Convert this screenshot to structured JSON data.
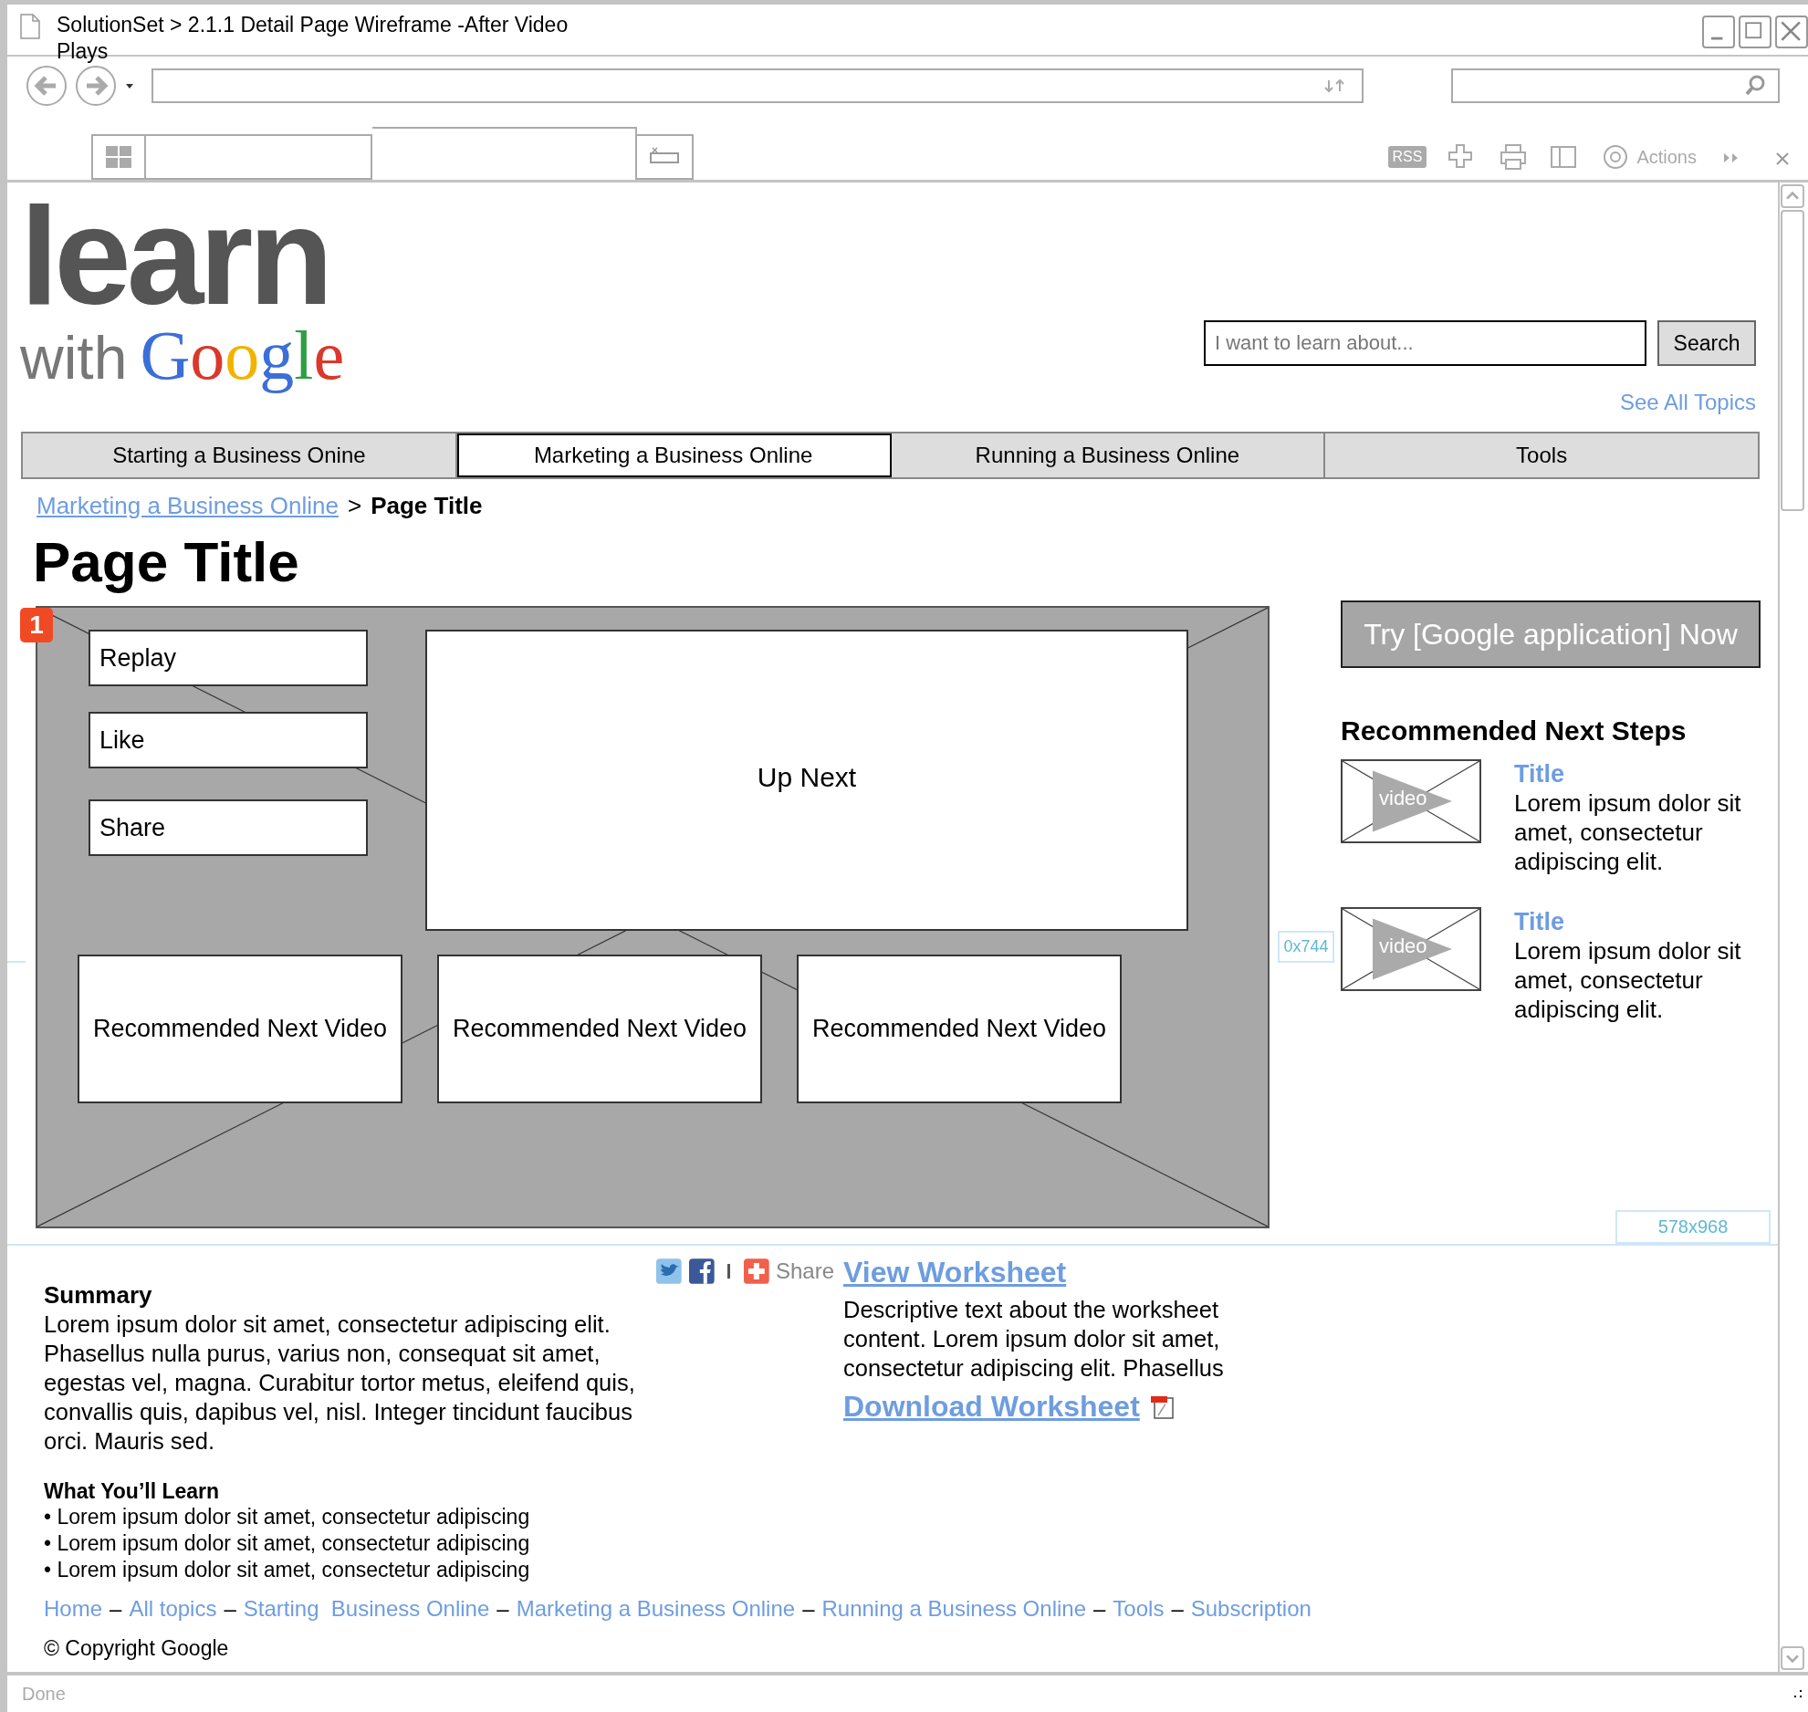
{
  "window": {
    "title": "SolutionSet > 2.1.1 Detail Page Wireframe -After Video Plays"
  },
  "toolbar": {
    "rss": "RSS",
    "actions": "Actions"
  },
  "header": {
    "logo_top": "learn",
    "logo_with": "with",
    "logo_google": "Google",
    "search": {
      "placeholder": "I want to learn about...",
      "button": "Search"
    },
    "see_all": "See All Topics"
  },
  "nav_tabs": [
    {
      "label": "Starting a Business Onine",
      "selected": false
    },
    {
      "label": "Marketing a Business Online",
      "selected": true
    },
    {
      "label": "Running a Business Online",
      "selected": false
    },
    {
      "label": "Tools",
      "selected": false
    }
  ],
  "breadcrumb": {
    "link": "Marketing a Business Online",
    "separator": ">",
    "current": "Page Title"
  },
  "page_title": "Page Title",
  "annotation_badge": "1",
  "video": {
    "actions": [
      "Replay",
      "Like",
      "Share"
    ],
    "up_next": "Up Next",
    "recommended": [
      "Recommended Next Video",
      "Recommended Next Video",
      "Recommended Next Video"
    ]
  },
  "guides": [
    "0x744",
    "578x968"
  ],
  "sidebar": {
    "cta": "Try [Google application] Now",
    "heading": "Recommended Next Steps",
    "items": [
      {
        "thumb_label": "video",
        "title": "Title",
        "text": "Lorem ipsum dolor sit amet, consectetur adipiscing elit."
      },
      {
        "thumb_label": "video",
        "title": "Title",
        "text": "Lorem ipsum dolor sit amet, consectetur adipiscing elit."
      }
    ]
  },
  "summary": {
    "heading": "Summary",
    "text": "Lorem ipsum dolor sit amet, consectetur adipiscing elit. Phasellus nulla purus, varius non, consequat sit amet, egestas vel, magna. Curabitur tortor metus, eleifend quis, convallis quis, dapibus vel, nisl. Integer tincidunt faucibus orci. Mauris sed.",
    "share_label": "Share"
  },
  "learn": {
    "heading": "What You’ll Learn",
    "bullets": [
      "• Lorem ipsum dolor sit amet, consectetur adipiscing",
      "• Lorem ipsum dolor sit amet, consectetur adipiscing",
      "• Lorem ipsum dolor sit amet, consectetur adipiscing"
    ]
  },
  "worksheet": {
    "view": "View Worksheet",
    "description": "Descriptive text about the worksheet content. Lorem ipsum dolor sit amet, consectetur adipiscing elit. Phasellus",
    "download": "Download Worksheet"
  },
  "footer": {
    "items": [
      {
        "kind": "link",
        "text": "Home"
      },
      {
        "kind": "separator",
        "text": "–"
      },
      {
        "kind": "link",
        "text": "All topics"
      },
      {
        "kind": "separator",
        "text": "–"
      },
      {
        "kind": "link",
        "text": "Starting  Business Online"
      },
      {
        "kind": "separator",
        "text": "–"
      },
      {
        "kind": "link",
        "text": "Marketing a Business Online"
      },
      {
        "kind": "separator",
        "text": "–"
      },
      {
        "kind": "link",
        "text": "Running a Business Online"
      },
      {
        "kind": "separator",
        "text": "–"
      },
      {
        "kind": "link",
        "text": "Tools"
      },
      {
        "kind": "separator",
        "text": "–"
      },
      {
        "kind": "link",
        "text": "Subscription"
      }
    ],
    "copyright": "© Copyright Google"
  },
  "status_bar": "Done"
}
